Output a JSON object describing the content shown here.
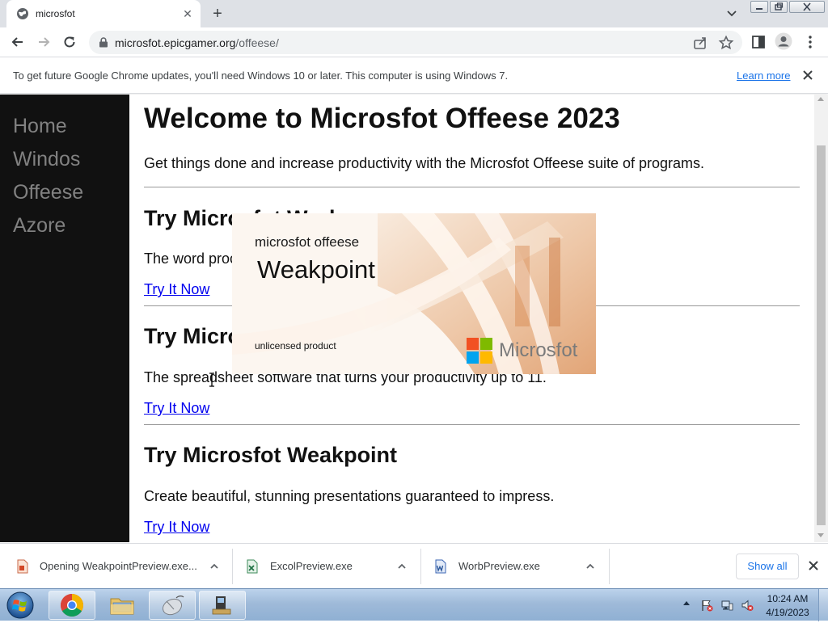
{
  "browser": {
    "tab": {
      "title": "microsfot",
      "close_glyph": "✕",
      "favicon": "globe-icon"
    },
    "newtab_glyph": "+",
    "address": {
      "host": "microsfot.epicgamer.org",
      "path": "/offeese/"
    },
    "infobar": {
      "message": "To get future Google Chrome updates, you'll need Windows 10 or later. This computer is using Windows 7.",
      "link_label": "Learn more"
    }
  },
  "page": {
    "nav": [
      "Home",
      "Windos",
      "Offeese",
      "Azore"
    ],
    "title": "Welcome to Microsfot Offeese 2023",
    "intro": "Get things done and increase productivity with the Microsfot Offeese suite of programs.",
    "sections": [
      {
        "heading": "Try Microsfot Worb",
        "text": "The word processor that writes for you.",
        "link": "Try It Now"
      },
      {
        "heading": "Try Microsfot Excol",
        "text": "The spreadsheet software that turns your productivity up to 11.",
        "link": "Try It Now"
      },
      {
        "heading": "Try Microsfot Weakpoint",
        "text": "Create beautiful, stunning presentations guaranteed to impress.",
        "link": "Try It Now"
      }
    ]
  },
  "splash": {
    "suite": "microsfot offeese",
    "product": "Weakpoint",
    "license": "unlicensed product",
    "brand": "Microsfot",
    "logo_colors": [
      "#f25022",
      "#7fba00",
      "#00a4ef",
      "#ffb900"
    ]
  },
  "downloads": {
    "items": [
      {
        "name": "Opening WeakpointPreview.exe...",
        "icon": "weakpoint-file-icon"
      },
      {
        "name": "ExcolPreview.exe",
        "icon": "excol-file-icon"
      },
      {
        "name": "WorbPreview.exe",
        "icon": "worb-file-icon"
      }
    ],
    "show_all": "Show all"
  },
  "taskbar": {
    "clock_time": "10:24 AM",
    "clock_date": "4/19/2023"
  },
  "colors": {
    "sidebar": "#111111",
    "nav_text": "#818181",
    "link": "#0000ee",
    "chrome_blue": "#1a73e8"
  }
}
